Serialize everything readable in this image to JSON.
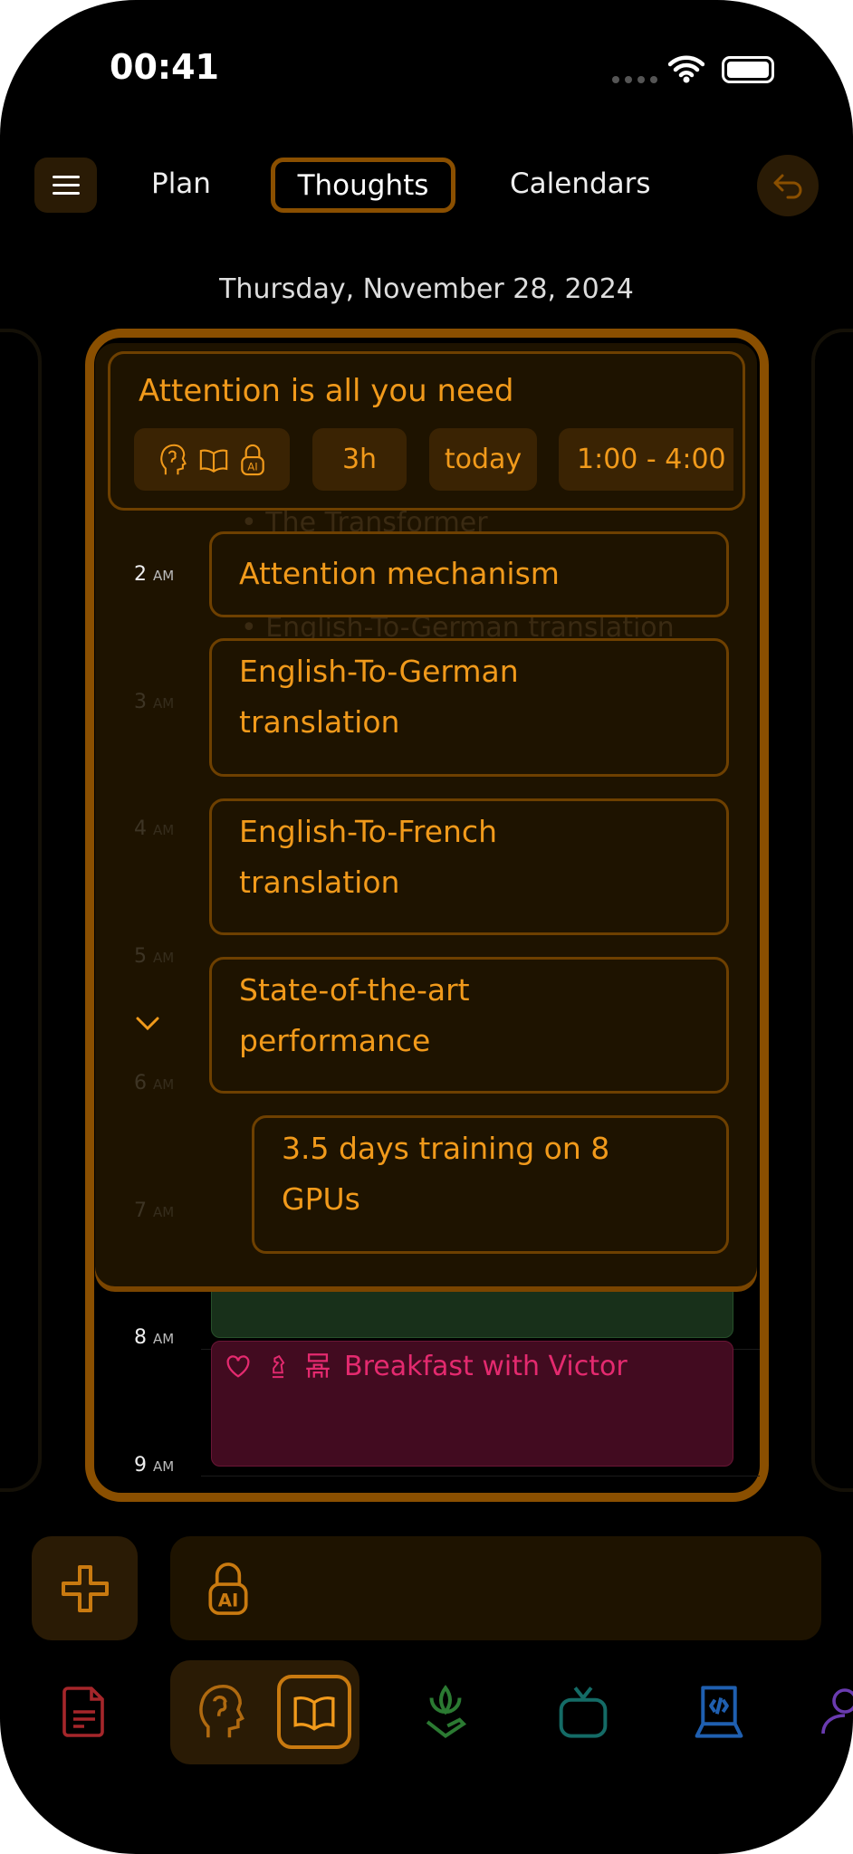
{
  "status_bar": {
    "time": "00:41"
  },
  "header": {
    "tabs": [
      {
        "label": "Plan"
      },
      {
        "label": "Thoughts",
        "active": true
      },
      {
        "label": "Calendars"
      }
    ]
  },
  "date": "Thursday, November 28, 2024",
  "colors": {
    "accent": "#f19a1b",
    "border": "#8a4f00",
    "breakfast": "#e42a6f",
    "green_event": "#18301a"
  },
  "calendar": {
    "hours": [
      {
        "h": "2",
        "ampm": "AM"
      },
      {
        "h": "3",
        "ampm": "AM"
      },
      {
        "h": "4",
        "ampm": "AM"
      },
      {
        "h": "5",
        "ampm": "AM"
      },
      {
        "h": "6",
        "ampm": "AM"
      },
      {
        "h": "7",
        "ampm": "AM"
      },
      {
        "h": "8",
        "ampm": "AM"
      },
      {
        "h": "9",
        "ampm": "AM"
      }
    ],
    "background_lines": [
      "• The Transformer",
      "• English-To-German translation"
    ],
    "events": [
      {
        "title": "Breakfast with Victor",
        "icons": [
          "heart-icon",
          "chess-knight-icon",
          "restaurant-icon"
        ]
      }
    ]
  },
  "thought": {
    "title": "Attention is all you need",
    "icons": [
      "brain-head-icon",
      "book-icon",
      "ai-lock-icon"
    ],
    "duration": "3h",
    "day": "today",
    "time_range": "1:00 - 4:00",
    "items": [
      {
        "text": "Attention mechanism"
      },
      {
        "text": "English-To-German translation"
      },
      {
        "text": "English-To-French translation"
      },
      {
        "text": "State-of-the-art performance"
      },
      {
        "text": "3.5 days training on 8 GPUs",
        "indent": 1
      }
    ]
  },
  "input": {
    "placeholder": ""
  },
  "tabbar": [
    "document-icon",
    "brain-head-icon",
    "book-icon",
    "plant-hand-icon",
    "tv-icon",
    "laptop-code-icon",
    "person-icon"
  ]
}
